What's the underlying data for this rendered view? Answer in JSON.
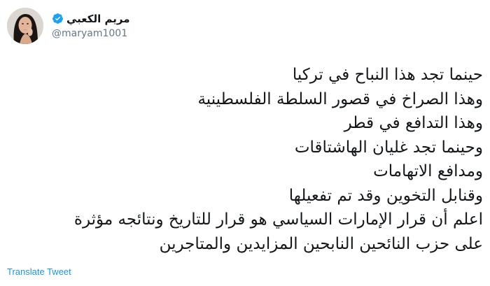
{
  "user": {
    "display_name": "مريم الكعبي",
    "handle": "@maryam1001",
    "verified": true,
    "verified_color": "#1da1f2",
    "avatar_icon": "profile-photo"
  },
  "tweet": {
    "lines": [
      "حينما تجد هذا النباح في تركيا",
      "وهذا الصراخ في قصور السلطة الفلسطينية",
      "وهذا التدافع في قطر",
      "وحينما تجد غليان الهاشتاقات",
      "ومدافع الاتهامات",
      "وقنابل التخوين وقد تم تفعيلها",
      "اعلم أن قرار الإمارات السياسي هو قرار للتاريخ ونتائجه مؤثرة",
      "على حزب النائحين النابحين المزايدين والمتاجرين"
    ]
  },
  "actions": {
    "translate_label": "Translate Tweet",
    "link_color": "#1b95e0"
  }
}
